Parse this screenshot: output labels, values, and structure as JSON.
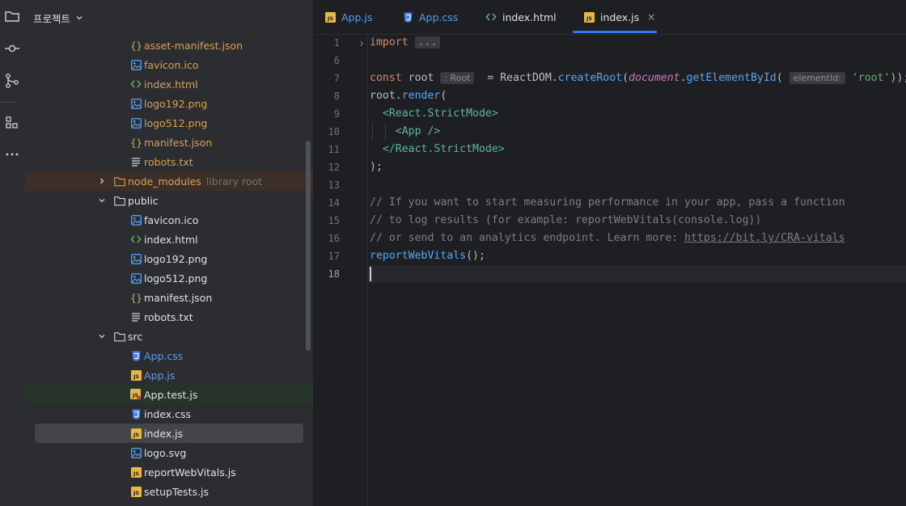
{
  "project_panel": {
    "title": "프로젝트",
    "tree": [
      {
        "label": "asset-manifest.json",
        "icon": "json-icon",
        "tone": "orange"
      },
      {
        "label": "favicon.ico",
        "icon": "image-icon",
        "tone": "orange"
      },
      {
        "label": "index.html",
        "icon": "html-icon",
        "tone": "orange"
      },
      {
        "label": "logo192.png",
        "icon": "image-icon",
        "tone": "orange"
      },
      {
        "label": "logo512.png",
        "icon": "image-icon",
        "tone": "orange"
      },
      {
        "label": "manifest.json",
        "icon": "json-icon",
        "tone": "orange"
      },
      {
        "label": "robots.txt",
        "icon": "text-icon",
        "tone": "orange"
      },
      {
        "label": "node_modules",
        "hint": "library root",
        "icon": "folder-icon",
        "tone": "orange",
        "state": "collapsed"
      },
      {
        "label": "public",
        "icon": "folder-icon",
        "tone": "plain",
        "state": "expanded"
      },
      {
        "label": "favicon.ico",
        "icon": "image-icon",
        "tone": "plain"
      },
      {
        "label": "index.html",
        "icon": "html-icon",
        "tone": "plain"
      },
      {
        "label": "logo192.png",
        "icon": "image-icon",
        "tone": "plain"
      },
      {
        "label": "logo512.png",
        "icon": "image-icon",
        "tone": "plain"
      },
      {
        "label": "manifest.json",
        "icon": "json-icon",
        "tone": "plain"
      },
      {
        "label": "robots.txt",
        "icon": "text-icon",
        "tone": "plain"
      },
      {
        "label": "src",
        "icon": "folder-icon",
        "tone": "plain",
        "state": "expanded"
      },
      {
        "label": "App.css",
        "icon": "css-icon",
        "tone": "blue"
      },
      {
        "label": "App.js",
        "icon": "js-icon",
        "tone": "blue"
      },
      {
        "label": "App.test.js",
        "icon": "js-test-icon",
        "tone": "plain"
      },
      {
        "label": "index.css",
        "icon": "css-icon",
        "tone": "plain"
      },
      {
        "label": "index.js",
        "icon": "js-icon",
        "tone": "plain",
        "selected": true
      },
      {
        "label": "logo.svg",
        "icon": "image-icon",
        "tone": "plain"
      },
      {
        "label": "reportWebVitals.js",
        "icon": "js-icon",
        "tone": "plain"
      },
      {
        "label": "setupTests.js",
        "icon": "js-icon",
        "tone": "plain"
      }
    ]
  },
  "tabs": [
    {
      "label": "App.js",
      "icon": "js-icon",
      "tone": "blue"
    },
    {
      "label": "App.css",
      "icon": "css-icon",
      "tone": "blue"
    },
    {
      "label": "index.html",
      "icon": "html-icon",
      "tone": "plain"
    },
    {
      "label": "index.js",
      "icon": "js-icon",
      "tone": "plain",
      "active": true,
      "close": "×"
    }
  ],
  "editor": {
    "line_numbers": [
      "1",
      "6",
      "7",
      "8",
      "9",
      "10",
      "11",
      "12",
      "13",
      "14",
      "15",
      "16",
      "17",
      "18"
    ],
    "current_line": "18",
    "code": {
      "l1_kw": "import",
      "l1_fold": "...",
      "l7_kw": "const",
      "l7_var": " root",
      "l7_hint": ": Root",
      "l7_mid": "  = ReactDOM.",
      "l7_fn": "createRoot",
      "l7_paren": "(",
      "l7_glob": "document",
      "l7_dot": ".",
      "l7_fn2": "getElementById",
      "l7_paren2": "(",
      "l7_param": "elementId:",
      "l7_str": "'root'",
      "l7_end": "));",
      "l8_a": "root.",
      "l8_fn": "render",
      "l8_b": "(",
      "l9_tag": "<React.StrictMode>",
      "l10_tag": "<App />",
      "l11_tag": "</React.StrictMode>",
      "l12": ");",
      "l14": "// If you want to start measuring performance in your app, pass a function",
      "l15": "// to log results (for example: reportWebVitals(console.log))",
      "l16_a": "// or send to an analytics endpoint. Learn more: ",
      "l16_link": "https://bit.ly/CRA-vitals",
      "l17_fn": "reportWebVitals",
      "l17_b": "();"
    }
  },
  "colors": {
    "accent": "#3574f0",
    "keyword": "#cf8e6d",
    "function": "#56a8f5",
    "string": "#6aab73",
    "comment": "#7a7e85",
    "excluded_folder": "#d6a158"
  }
}
